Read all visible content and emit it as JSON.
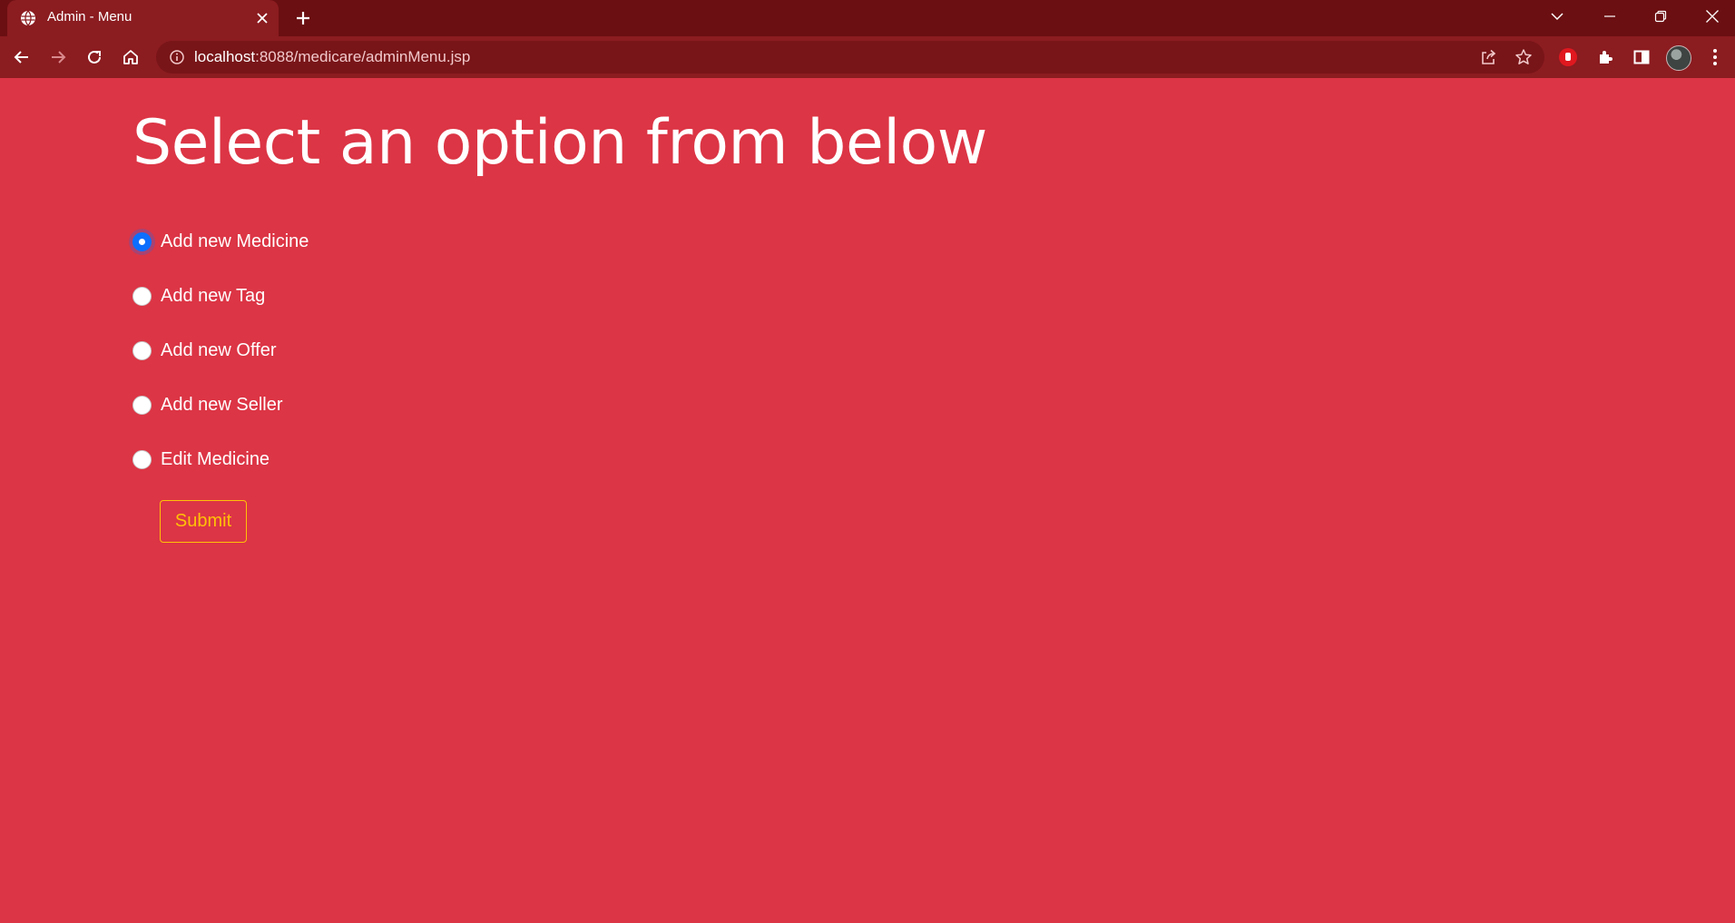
{
  "browser": {
    "tab_title": "Admin - Menu",
    "url_host": "localhost",
    "url_rest": ":8088/medicare/adminMenu.jsp",
    "icons": {
      "tab": "globe-icon",
      "close": "close-icon",
      "new_tab": "plus-icon",
      "nav": [
        "back-arrow-icon",
        "forward-arrow-icon",
        "reload-icon",
        "home-icon"
      ],
      "omnibox": [
        "info-icon",
        "share-icon",
        "star-icon"
      ],
      "extensions": [
        "stop-hand-extension-icon",
        "puzzle-icon",
        "side-panel-icon"
      ],
      "window": [
        "tab-search-chevron-icon",
        "minimize-icon",
        "restore-icon",
        "window-close-icon"
      ]
    }
  },
  "page": {
    "title": "Select an option from below",
    "options": [
      {
        "label": "Add new Medicine",
        "checked": true
      },
      {
        "label": "Add new Tag",
        "checked": false
      },
      {
        "label": "Add new Offer",
        "checked": false
      },
      {
        "label": "Add new Seller",
        "checked": false
      },
      {
        "label": "Edit Medicine",
        "checked": false
      }
    ],
    "submit_label": "Submit"
  },
  "colors": {
    "page_background": "#dc3545",
    "tabbar": "#6b0f12",
    "toolbar": "#8b1c20",
    "radio_checked": "#0d6efd",
    "submit_outline": "#ffc107"
  }
}
